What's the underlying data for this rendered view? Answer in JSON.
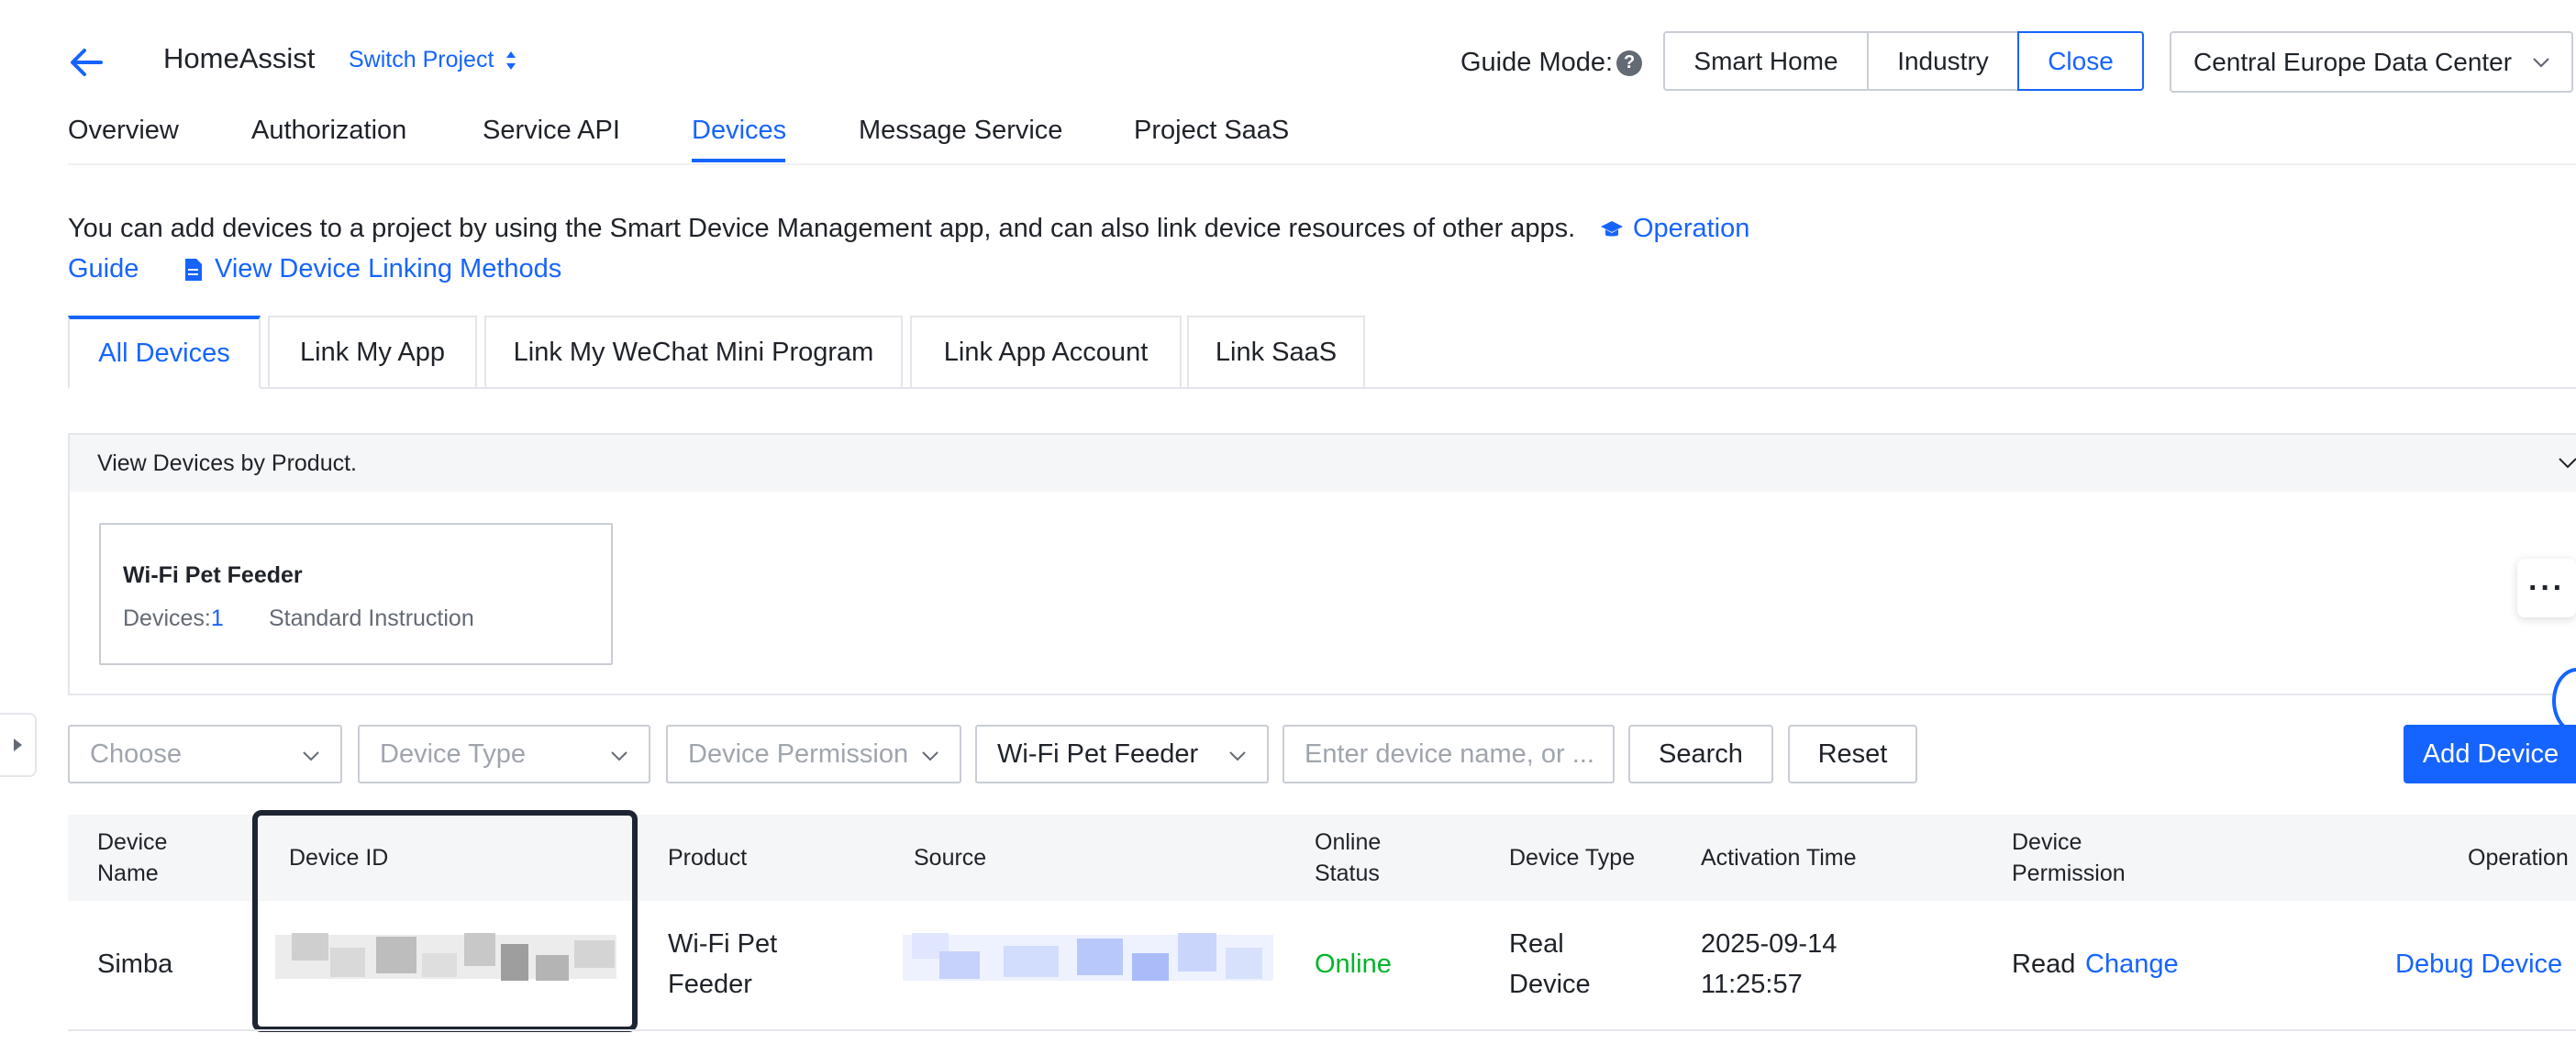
{
  "header": {
    "project_name": "HomeAssist",
    "switch_project": "Switch Project",
    "guide_mode_label": "Guide Mode:",
    "guide_help": "?",
    "guide_modes": [
      "Smart Home",
      "Industry",
      "Close"
    ],
    "active_guide_mode": "Close",
    "region": "Central Europe Data Center"
  },
  "top_nav": {
    "items": [
      "Overview",
      "Authorization",
      "Service API",
      "Devices",
      "Message Service",
      "Project SaaS"
    ],
    "active": "Devices"
  },
  "info": {
    "text": "You can add devices to a project by using the Smart Device Management app, and can also link device resources of other apps.",
    "operation_guide_part1": "Operation",
    "operation_guide_part2": "Guide",
    "view_linking_methods": "View Device Linking Methods"
  },
  "sub_tabs": {
    "items": [
      "All Devices",
      "Link My App",
      "Link My WeChat Mini Program",
      "Link App Account",
      "Link SaaS"
    ],
    "active": "All Devices"
  },
  "product_panel": {
    "title": "View Devices by Product.",
    "card": {
      "name": "Wi-Fi Pet Feeder",
      "devices_label": "Devices:",
      "devices_count": "1",
      "type": "Standard Instruction"
    }
  },
  "filters": {
    "choose_placeholder": "Choose",
    "device_type_placeholder": "Device Type",
    "device_permission_placeholder": "Device Permission",
    "product_value": "Wi-Fi Pet Feeder",
    "search_placeholder": "Enter device name, or ...",
    "search_button": "Search",
    "reset_button": "Reset",
    "add_device_button": "Add Device"
  },
  "table": {
    "headers": {
      "device_name": [
        "Device",
        "Name"
      ],
      "device_id": "Device ID",
      "product": "Product",
      "source": "Source",
      "online_status": [
        "Online",
        "Status"
      ],
      "device_type": "Device Type",
      "activation_time": "Activation Time",
      "device_permission": [
        "Device",
        "Permission"
      ],
      "operation": "Operation"
    },
    "rows": [
      {
        "device_name": "Simba",
        "product": [
          "Wi-Fi Pet",
          "Feeder"
        ],
        "online_status": "Online",
        "device_type": [
          "Real",
          "Device"
        ],
        "activation_time": [
          "2025-09-14",
          "11:25:57"
        ],
        "permission": "Read",
        "change": "Change",
        "operation": "Debug Device"
      }
    ]
  },
  "colors": {
    "accent": "#1664ff",
    "online": "#00b42a",
    "text": "#1f2329",
    "muted": "#646a73",
    "border": "#c9cdd4"
  }
}
